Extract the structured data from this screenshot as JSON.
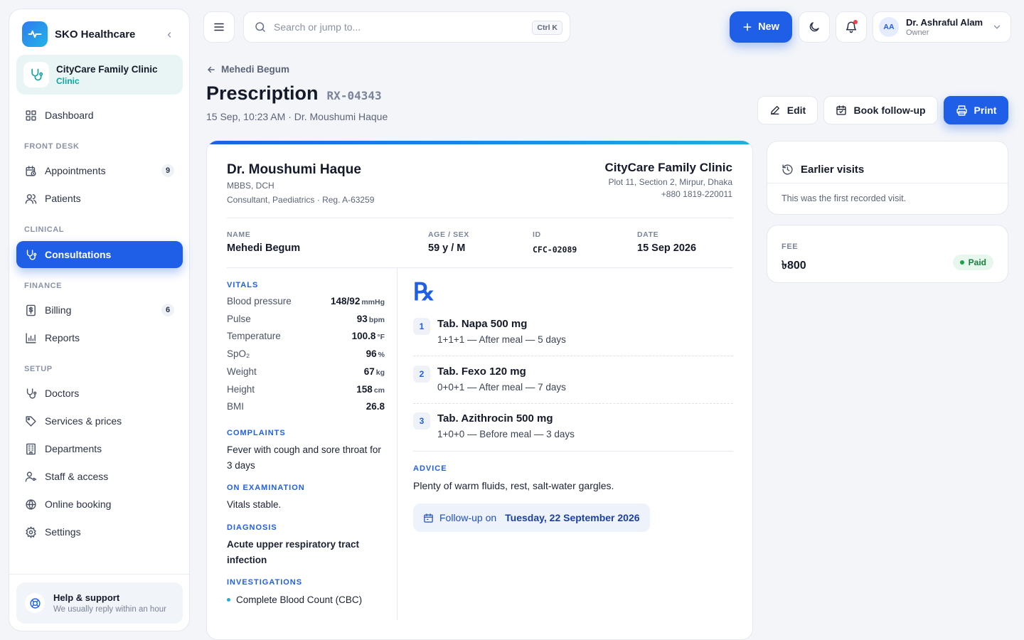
{
  "brand": {
    "name": "SKO Healthcare"
  },
  "clinic": {
    "name": "CityCare Family Clinic",
    "type": "Clinic"
  },
  "nav": {
    "dashboard": "Dashboard",
    "sections": {
      "front_desk": "FRONT DESK",
      "clinical": "CLINICAL",
      "finance": "FINANCE",
      "setup": "SETUP"
    },
    "appointments": {
      "label": "Appointments",
      "badge": "9"
    },
    "patients": "Patients",
    "consultations": "Consultations",
    "billing": {
      "label": "Billing",
      "badge": "6"
    },
    "reports": "Reports",
    "doctors": "Doctors",
    "services": "Services & prices",
    "departments": "Departments",
    "staff": "Staff & access",
    "online_booking": "Online booking",
    "settings": "Settings"
  },
  "help": {
    "title": "Help & support",
    "subtitle": "We usually reply within an hour"
  },
  "topbar": {
    "search_placeholder": "Search or jump to...",
    "shortcut": "Ctrl K",
    "new_label": "New",
    "user": {
      "initials": "AA",
      "name": "Dr. Ashraful Alam",
      "role": "Owner"
    }
  },
  "header": {
    "back_label": "Mehedi Begum",
    "title": "Prescription",
    "rx_code": "RX-04343",
    "subtitle": "15 Sep, 10:23 AM · Dr. Moushumi Haque",
    "edit_label": "Edit",
    "followup_label": "Book follow-up",
    "print_label": "Print"
  },
  "rx": {
    "doctor": {
      "name": "Dr. Moushumi Haque",
      "degrees": "MBBS, DCH",
      "role": "Consultant, Paediatrics · Reg. A-63259"
    },
    "clinic": {
      "name": "CityCare Family Clinic",
      "address": "Plot 11, Section 2, Mirpur, Dhaka",
      "phone": "+880 1819-220011"
    },
    "patient": {
      "name_label": "NAME",
      "name": "Mehedi Begum",
      "age_label": "AGE / SEX",
      "age": "59 y / M",
      "id_label": "ID",
      "id": "CFC-02089",
      "date_label": "DATE",
      "date": "15 Sep 2026"
    },
    "vitals_label": "VITALS",
    "vitals": [
      {
        "name": "Blood pressure",
        "value": "148/92",
        "unit": "mmHg"
      },
      {
        "name": "Pulse",
        "value": "93",
        "unit": "bpm"
      },
      {
        "name": "Temperature",
        "value": "100.8",
        "unit": "°F"
      },
      {
        "name": "SpO₂",
        "value": "96",
        "unit": "%"
      },
      {
        "name": "Weight",
        "value": "67",
        "unit": "kg"
      },
      {
        "name": "Height",
        "value": "158",
        "unit": "cm"
      },
      {
        "name": "BMI",
        "value": "26.8",
        "unit": ""
      }
    ],
    "complaints_label": "COMPLAINTS",
    "complaints": "Fever with cough and sore throat for 3 days",
    "examination_label": "ON EXAMINATION",
    "examination": "Vitals stable.",
    "diagnosis_label": "DIAGNOSIS",
    "diagnosis": "Acute upper respiratory tract infection",
    "investigations_label": "INVESTIGATIONS",
    "investigations": [
      "Complete Blood Count (CBC)"
    ],
    "symbol": "℞",
    "medicines": [
      {
        "num": "1",
        "name": "Tab. Napa 500 mg",
        "dose": "1+1+1 — After meal — 5 days"
      },
      {
        "num": "2",
        "name": "Tab. Fexo 120 mg",
        "dose": "0+0+1 — After meal — 7 days"
      },
      {
        "num": "3",
        "name": "Tab. Azithrocin 500 mg",
        "dose": "1+0+0 — Before meal — 3 days"
      }
    ],
    "advice_label": "ADVICE",
    "advice": "Plenty of warm fluids, rest, salt-water gargles.",
    "followup_prefix": "Follow-up on",
    "followup_date": "Tuesday, 22 September 2026"
  },
  "earlier_visits": {
    "title": "Earlier visits",
    "text": "This was the first recorded visit."
  },
  "fee": {
    "label": "FEE",
    "value": "৳800",
    "status": "Paid"
  },
  "colors": {
    "accent": "#1f5fe8",
    "teal": "#0ea5a0",
    "paid": "#16a34a"
  }
}
